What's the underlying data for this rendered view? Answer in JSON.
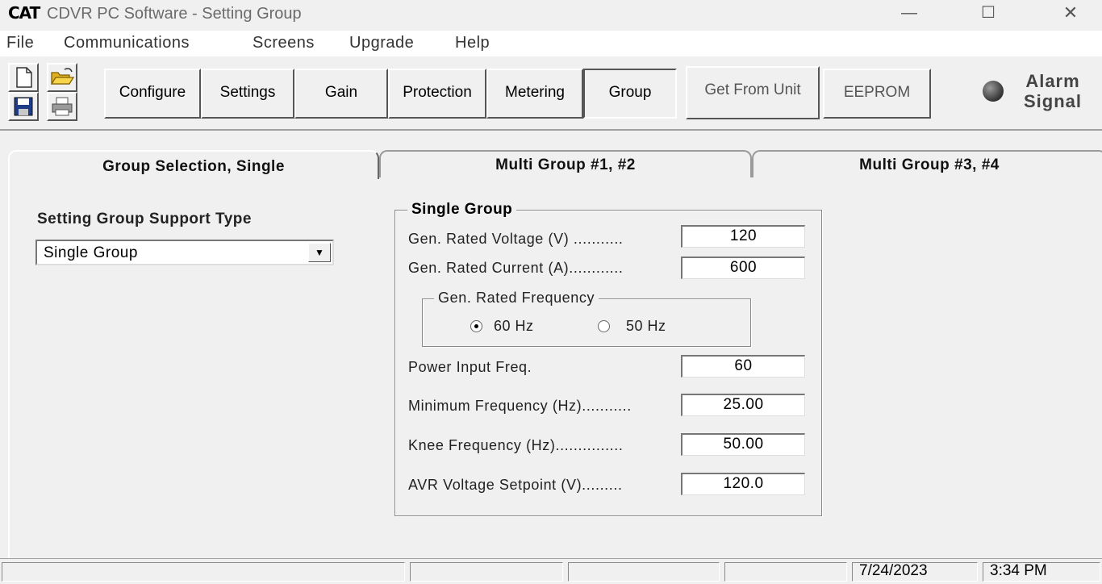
{
  "window": {
    "logo": "CAT",
    "title": "CDVR PC Software - Setting Group",
    "minimize": "—",
    "maximize": "☐",
    "close": "✕"
  },
  "menu": [
    "File",
    "Communications",
    "Screens",
    "Upgrade",
    "Help"
  ],
  "toolbar": {
    "icons": [
      "new-file-icon",
      "open-folder-icon",
      "save-icon",
      "print-icon"
    ],
    "buttons": {
      "configure": "Configure",
      "settings": "Settings",
      "gain": "Gain",
      "protection": "Protection",
      "metering": "Metering",
      "group": "Group",
      "get_from_unit": "Get From Unit",
      "eeprom": "EEPROM"
    },
    "alarm_label": "Alarm Signal"
  },
  "tabs": {
    "active": "Group Selection, Single",
    "tab2": "Multi Group #1, #2",
    "tab3": "Multi Group #3, #4"
  },
  "support_type": {
    "label": "Setting Group Support Type",
    "selected": "Single Group"
  },
  "single_group": {
    "title": "Single Group",
    "rated_voltage_label": "Gen. Rated Voltage (V) ...........",
    "rated_voltage": "120",
    "rated_current_label": "Gen. Rated Current (A)............",
    "rated_current": "600",
    "frequency": {
      "title": "Gen. Rated Frequency",
      "option_60": "60 Hz",
      "option_50": "50 Hz",
      "selected": "60 Hz"
    },
    "power_input_label": "Power Input Freq.",
    "power_input": "60",
    "min_freq_label": "Minimum Frequency (Hz)...........",
    "min_freq": "25.00",
    "knee_freq_label": "Knee Frequency (Hz)...............",
    "knee_freq": "50.00",
    "avr_label": "AVR Voltage Setpoint (V).........",
    "avr": "120.0"
  },
  "status": {
    "date": "7/24/2023",
    "time": "3:34 PM"
  }
}
